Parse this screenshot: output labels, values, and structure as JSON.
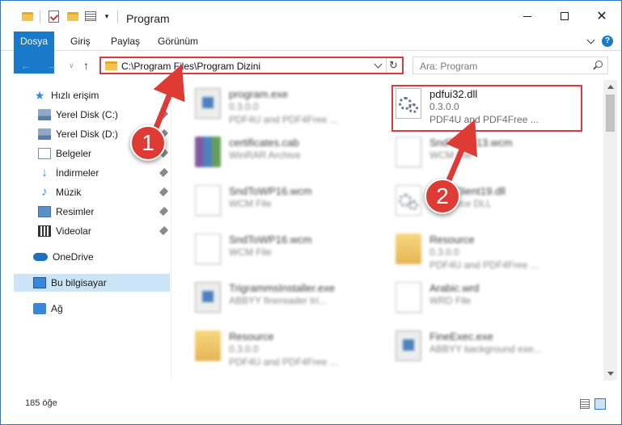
{
  "window": {
    "title": "Program",
    "minimize_glyph": "—",
    "maximize_glyph": "☐",
    "close_glyph": "✕"
  },
  "ribbon": {
    "tabs": [
      "Dosya",
      "Giriş",
      "Paylaş",
      "Görünüm"
    ],
    "help_glyph": "?"
  },
  "nav": {
    "back_glyph": "←",
    "forward_glyph": "→",
    "recent_glyph": "∨",
    "up_glyph": "↑",
    "address_path": "C:\\Program Files\\Program Dizini",
    "refresh_glyph": "↻",
    "search_placeholder": "Ara: Program"
  },
  "sidebar": {
    "items": [
      {
        "label": "Hızlı erişim",
        "icon": "star-icon",
        "pinned": false
      },
      {
        "label": "Yerel Disk (C:)",
        "icon": "disk-icon",
        "pinned": true
      },
      {
        "label": "Yerel Disk (D:)",
        "icon": "disk-icon",
        "pinned": true
      },
      {
        "label": "Belgeler",
        "icon": "documents-icon",
        "pinned": true
      },
      {
        "label": "İndirmeler",
        "icon": "downloads-icon",
        "pinned": true
      },
      {
        "label": "Müzik",
        "icon": "music-icon",
        "pinned": true
      },
      {
        "label": "Resimler",
        "icon": "pictures-icon",
        "pinned": true
      },
      {
        "label": "Videolar",
        "icon": "videos-icon",
        "pinned": true
      },
      {
        "label": "OneDrive",
        "icon": "onedrive-icon",
        "pinned": false
      },
      {
        "label": "Bu bilgisayar",
        "icon": "computer-icon",
        "pinned": false,
        "selected": true
      },
      {
        "label": "Ağ",
        "icon": "network-icon",
        "pinned": false
      }
    ]
  },
  "files": [
    {
      "name": "program.exe",
      "line2": "0.3.0.0",
      "line3": "PDF4U and PDF4Free ...",
      "icon": "exe-icon"
    },
    {
      "name": "pdfui32.dll",
      "line2": "0.3.0.0",
      "line3": "PDF4U and PDF4Free ...",
      "icon": "dll-gear-icon"
    },
    {
      "name": "certificates.cab",
      "line2": "WinRAR Archive",
      "line3": "",
      "icon": "rar-icon"
    },
    {
      "name": "SndToWP13.wcm",
      "line2": "WCM File",
      "line3": "",
      "icon": "file-icon"
    },
    {
      "name": "SndToWP16.wcm",
      "line2": "WCM File",
      "line3": "",
      "icon": "file-icon"
    },
    {
      "name": "SaveClient19.dll",
      "line2": "Resource DLL",
      "line3": "",
      "icon": "dll-gear-icon"
    },
    {
      "name": "SndToWP16.wcm",
      "line2": "WCM File",
      "line3": "",
      "icon": "file-icon"
    },
    {
      "name": "Resource",
      "line2": "0.3.0.0",
      "line3": "PDF4U and PDF4Free ...",
      "icon": "folder-icon"
    },
    {
      "name": "TrigrammsInstaller.exe",
      "line2": "ABBYY finereader tri...",
      "line3": "",
      "icon": "exe-icon"
    },
    {
      "name": "Arabic.wrd",
      "line2": "WRD File",
      "line3": "",
      "icon": "file-icon"
    },
    {
      "name": "Resource",
      "line2": "0.3.0.0",
      "line3": "PDF4U and PDF4Free ...",
      "icon": "folder-icon"
    },
    {
      "name": "FineExec.exe",
      "line2": "ABBYY background exe...",
      "line3": "",
      "icon": "exe-icon"
    }
  ],
  "annotations": {
    "step1": "1",
    "step2": "2",
    "color": "#df3b35"
  },
  "status": {
    "item_count": "185 öğe"
  }
}
